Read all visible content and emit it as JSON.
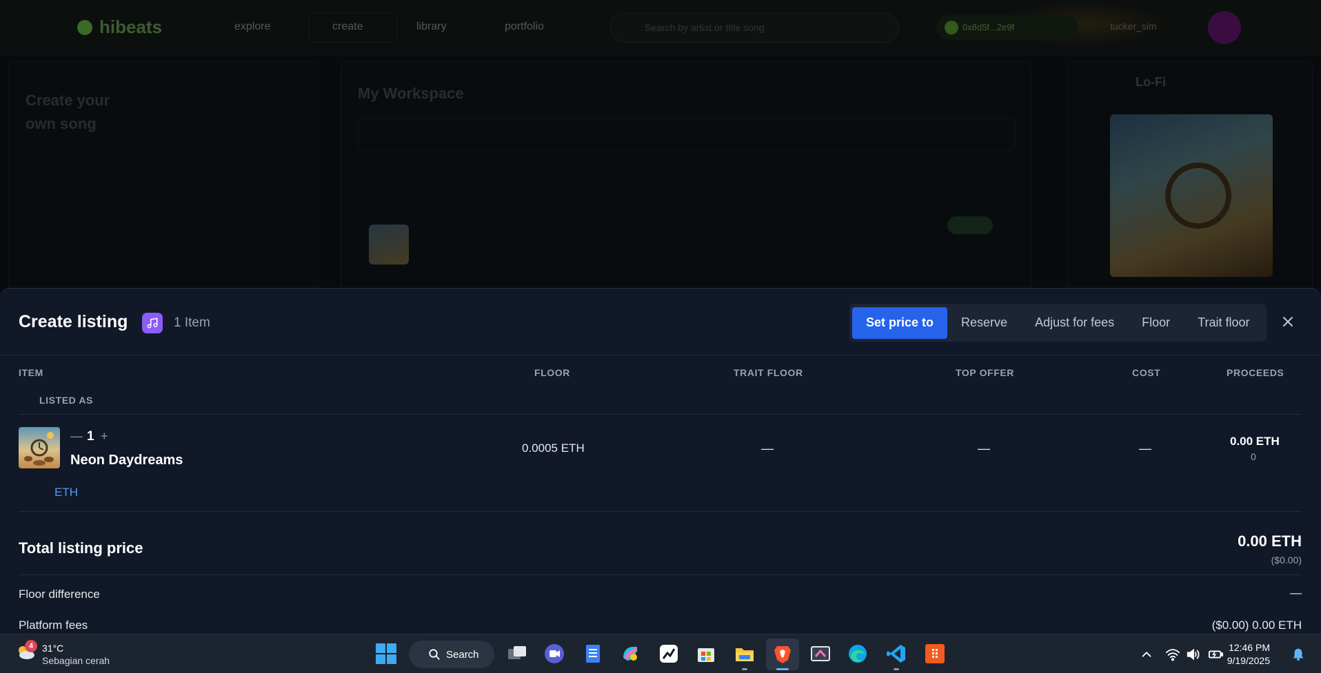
{
  "background": {
    "brand": "hibeats",
    "nav_links": [
      "explore",
      "create",
      "library",
      "portfolio"
    ],
    "search_placeholder": "Search by artist or title song",
    "wallet": "0x8d5f...2e9f",
    "user": "tucker_sim",
    "create_title": "Create your own song",
    "workspace_title": "My Workspace",
    "now_playing": "Lo-Fi"
  },
  "modal": {
    "title": "Create listing",
    "item_count": "1 Item",
    "tabs": [
      {
        "label": "Set price to",
        "active": true
      },
      {
        "label": "Reserve",
        "active": false
      },
      {
        "label": "Adjust for fees",
        "active": false
      },
      {
        "label": "Floor",
        "active": false
      },
      {
        "label": "Trait floor",
        "active": false
      }
    ],
    "columns": {
      "item": "ITEM",
      "listed_as": "LISTED AS",
      "floor": "FLOOR",
      "trait_floor": "TRAIT FLOOR",
      "top_offer": "TOP OFFER",
      "cost": "COST",
      "proceeds": "PROCEEDS"
    },
    "row": {
      "quantity": "1",
      "minus": "—",
      "plus": "+",
      "name": "Neon Daydreams",
      "listed_currency": "ETH",
      "floor": "0.0005 ETH",
      "trait_floor": "—",
      "top_offer": "—",
      "cost": "—",
      "proceeds": "0.00 ETH",
      "proceeds_sub": "0"
    },
    "summary": {
      "total_label": "Total listing price",
      "total_value": "0.00 ETH",
      "total_usd": "($0.00)",
      "floor_diff_label": "Floor difference",
      "floor_diff_value": "—",
      "platform_fees_label": "Platform fees",
      "platform_fees_value": "($0.00) 0.00 ETH"
    }
  },
  "taskbar": {
    "weather_badge": "4",
    "weather_temp": "31°C",
    "weather_desc": "Sebagian cerah",
    "search_label": "Search",
    "time": "12:46 PM",
    "date": "9/19/2025"
  },
  "colors": {
    "accent": "#2563eb",
    "modal_bg": "#111827",
    "link": "#4f9cf7",
    "music_badge": "#8b5cf6"
  }
}
